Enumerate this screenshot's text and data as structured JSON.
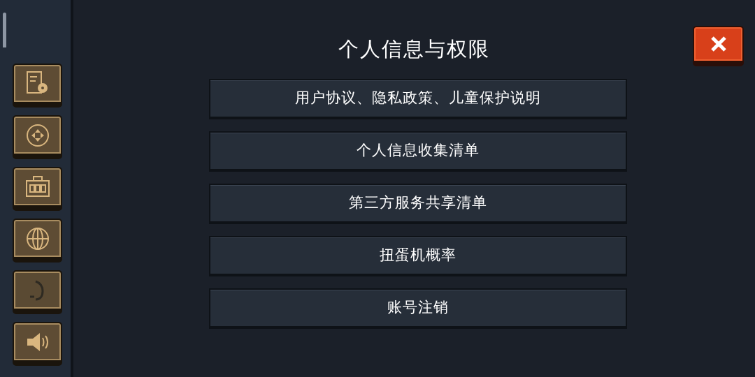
{
  "sidebar": {
    "tabs": [
      {
        "kind": "settings",
        "disabled": false
      },
      {
        "kind": "controls",
        "disabled": false
      },
      {
        "kind": "toolbox",
        "disabled": false
      },
      {
        "kind": "language",
        "disabled": false
      },
      {
        "kind": "music",
        "disabled": true
      },
      {
        "kind": "sound",
        "disabled": false
      }
    ]
  },
  "title": "个人信息与权限",
  "menu": [
    "用户协议、隐私政策、儿童保护说明",
    "个人信息收集清单",
    "第三方服务共享清单",
    "扭蛋机概率",
    "账号注销"
  ]
}
